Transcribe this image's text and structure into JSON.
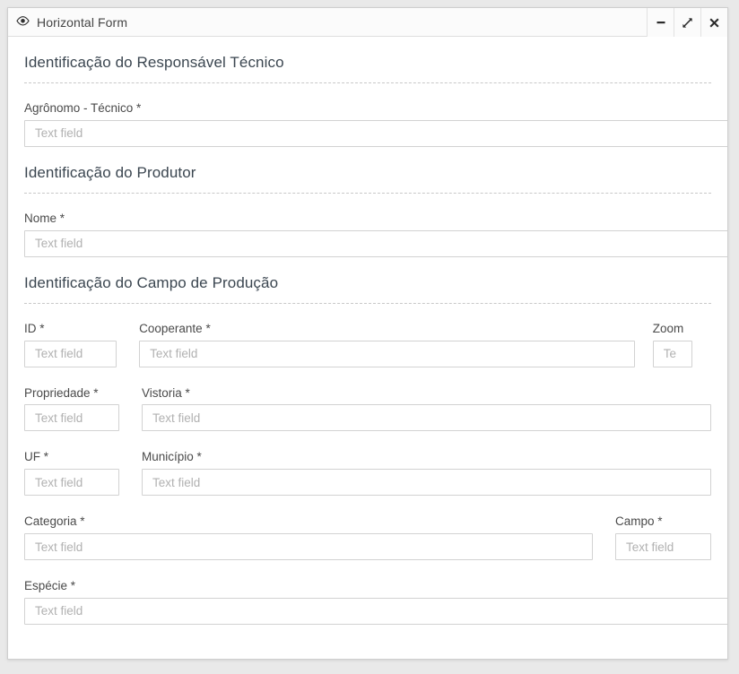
{
  "window": {
    "title": "Horizontal Form",
    "eye_icon": "eye-icon",
    "buttons": {
      "minimize": {
        "label": "−",
        "name": "minimize-icon"
      },
      "expand": {
        "label": "↗",
        "name": "expand-icon"
      },
      "close": {
        "label": "✕",
        "name": "close-icon"
      }
    }
  },
  "placeholder": "Text field",
  "sections": [
    {
      "title": "Identificação do Responsável Técnico",
      "fields": [
        {
          "label": "Agrônomo - Técnico *",
          "placeholder": "Text field"
        }
      ]
    },
    {
      "title": "Identificação do Produtor",
      "fields": [
        {
          "label": "Nome *",
          "placeholder": "Text field"
        }
      ]
    },
    {
      "title": "Identificação do Campo de Produção",
      "fields": [
        {
          "label": "ID *",
          "placeholder": "Text field"
        },
        {
          "label": "Cooperante *",
          "placeholder": "Text field"
        },
        {
          "label": "Zoom",
          "placeholder": "Te"
        },
        {
          "label": "Propriedade *",
          "placeholder": "Text field"
        },
        {
          "label": "Vistoria *",
          "placeholder": "Text field"
        },
        {
          "label": "UF *",
          "placeholder": "Text field"
        },
        {
          "label": "Município *",
          "placeholder": "Text field"
        },
        {
          "label": "Categoria *",
          "placeholder": "Text field"
        },
        {
          "label": "Campo *",
          "placeholder": "Text field"
        },
        {
          "label": "Espécie *",
          "placeholder": "Text field"
        }
      ]
    }
  ],
  "colors": {
    "window_background": "#ffffff",
    "page_background": "#e9e9e9",
    "titlebar_background": "#fbfbfb",
    "border": "#cfcfcf",
    "section_title": "#3b4650",
    "label": "#4a4a4a",
    "placeholder": "#b1b1b1",
    "input_border": "#d2d2d2",
    "divider": "#c8c8c8"
  }
}
